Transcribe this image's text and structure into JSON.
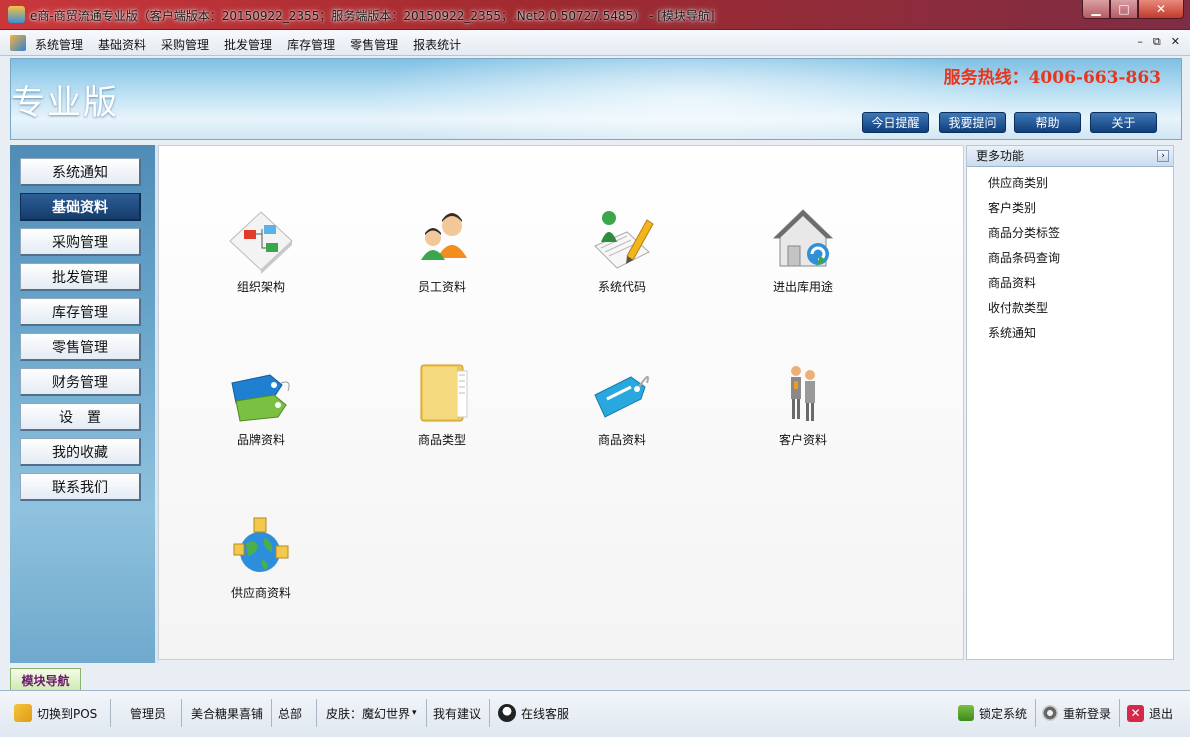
{
  "window": {
    "title": "e商-商贸流通专业版（客户端版本：20150922_2355；服务端版本：20150922_2355；.Net2.0.50727.5485） - [模块导航]",
    "controls": {
      "minimize": "▁",
      "maximize": "□",
      "close": "✕"
    }
  },
  "menubar": {
    "items": [
      "系统管理",
      "基础资料",
      "采购管理",
      "批发管理",
      "库存管理",
      "零售管理",
      "报表统计"
    ],
    "mdi_controls": [
      "–",
      "⧉",
      "✕"
    ]
  },
  "header": {
    "edition": "专业版",
    "hotline": "服务热线：4006-663-863",
    "buttons": [
      "今日提醒",
      "我要提问",
      "帮助",
      "关于"
    ]
  },
  "sidebar": {
    "items": [
      {
        "label": "系统通知",
        "active": false
      },
      {
        "label": "基础资料",
        "active": true
      },
      {
        "label": "采购管理",
        "active": false
      },
      {
        "label": "批发管理",
        "active": false
      },
      {
        "label": "库存管理",
        "active": false
      },
      {
        "label": "零售管理",
        "active": false
      },
      {
        "label": "财务管理",
        "active": false
      },
      {
        "label": "设　置",
        "active": false
      },
      {
        "label": "我的收藏",
        "active": false
      },
      {
        "label": "联系我们",
        "active": false
      }
    ]
  },
  "main": {
    "tiles": [
      {
        "label": "组织架构",
        "icon": "org-chart-icon"
      },
      {
        "label": "员工资料",
        "icon": "employees-icon"
      },
      {
        "label": "系统代码",
        "icon": "system-code-icon"
      },
      {
        "label": "进出库用途",
        "icon": "warehouse-house-icon"
      },
      {
        "label": "品牌资料",
        "icon": "brand-tags-icon"
      },
      {
        "label": "商品类型",
        "icon": "folder-icon"
      },
      {
        "label": "商品资料",
        "icon": "price-tag-icon"
      },
      {
        "label": "客户资料",
        "icon": "customers-icon"
      },
      {
        "label": "供应商资料",
        "icon": "supplier-globe-icon"
      }
    ]
  },
  "more_panel": {
    "title": "更多功能",
    "toggle": "›",
    "items": [
      "供应商类别",
      "客户类别",
      "商品分类标签",
      "商品条码查询",
      "商品资料",
      "收付款类型",
      "系统通知"
    ]
  },
  "bottom_tab": {
    "label": "模块导航"
  },
  "statusbar": {
    "switch_pos": "切换到POS",
    "user": "管理员",
    "store": "美合糖果喜铺",
    "branch": "总部",
    "skin": "皮肤：魔幻世界",
    "skin_arrow": "▾",
    "suggest": "我有建议",
    "online_service": "在线客服",
    "lock": "锁定系统",
    "relogin": "重新登录",
    "exit": "退出"
  },
  "colors": {
    "titlebar": "#b0303a",
    "hotline": "#e8361c",
    "active_nav": "#1e4a80",
    "sidebar": "#6aa6cb"
  }
}
